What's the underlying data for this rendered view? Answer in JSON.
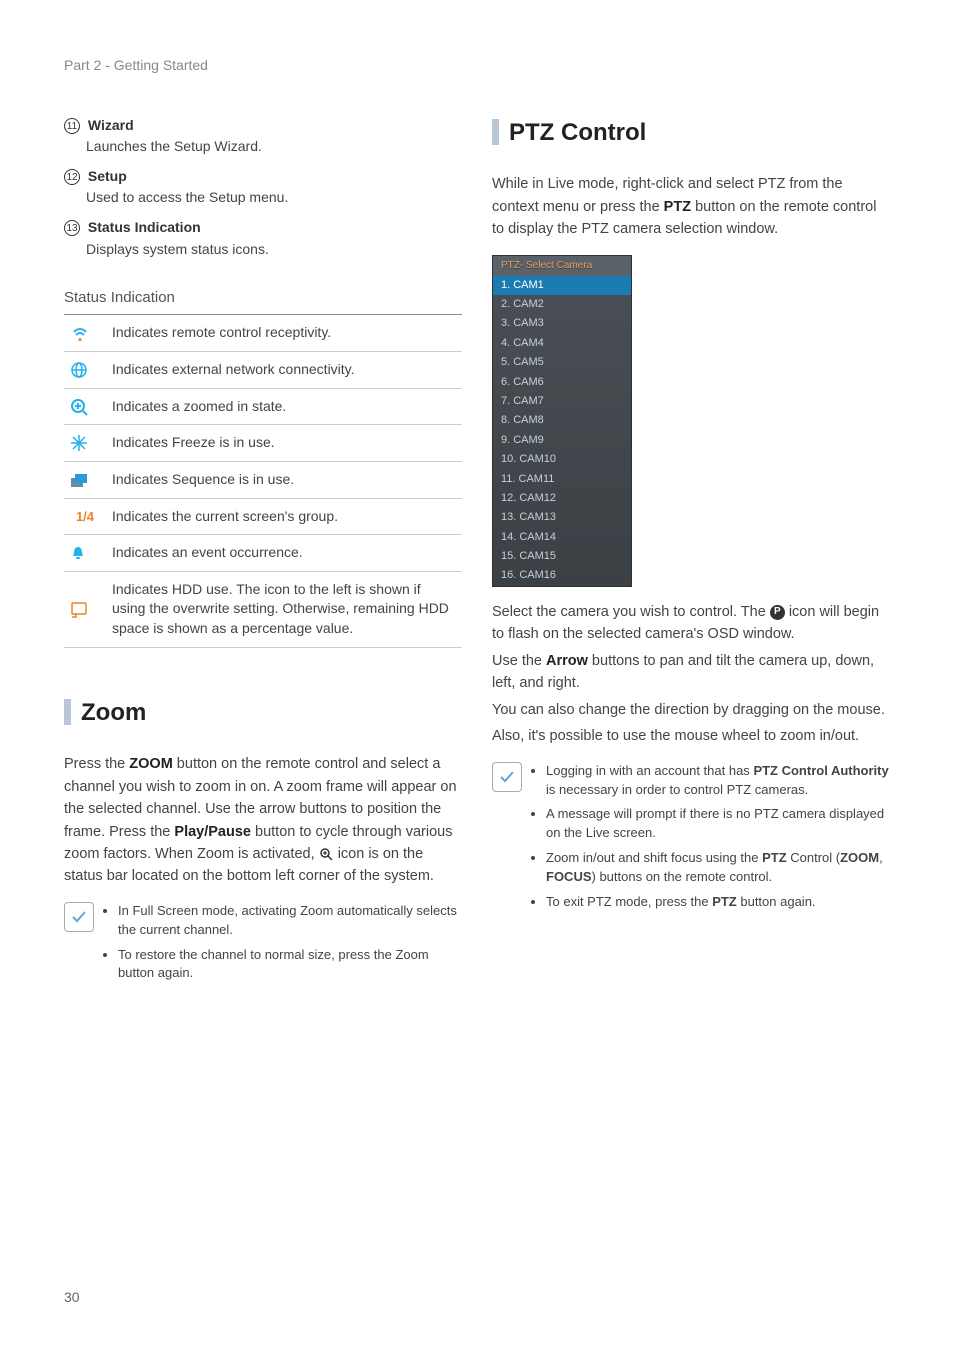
{
  "header": {
    "breadcrumb": "Part 2 - Getting Started"
  },
  "left": {
    "items": [
      {
        "num": "⑪",
        "title": "Wizard",
        "desc": "Launches the Setup Wizard."
      },
      {
        "num": "⑫",
        "title": "Setup",
        "desc": "Used to access the Setup menu."
      },
      {
        "num": "⑬",
        "title": " Status Indication",
        "desc": "Displays system status icons."
      }
    ],
    "status_heading": "Status Indication",
    "status_rows": [
      {
        "icon": "remote",
        "desc": "Indicates remote control receptivity."
      },
      {
        "icon": "globe",
        "desc": "Indicates external network connectivity."
      },
      {
        "icon": "zoomin",
        "desc": "Indicates a zoomed in state."
      },
      {
        "icon": "freeze",
        "desc": "Indicates Freeze is in use."
      },
      {
        "icon": "seq",
        "desc": "Indicates Sequence is in use."
      },
      {
        "icon": "group",
        "label": "1/4",
        "desc": "Indicates the current screen's group."
      },
      {
        "icon": "event",
        "desc": "Indicates an event occurrence."
      },
      {
        "icon": "hdd",
        "desc": "Indicates HDD use. The icon to the left is shown if using the overwrite setting. Otherwise, remaining HDD space is shown as a percentage value."
      }
    ],
    "zoom_title": "Zoom",
    "zoom_body_parts": [
      "Press the ",
      "ZOOM",
      " button on the remote control and select a channel you wish to zoom in on. A zoom frame will appear on the selected channel. Use the arrow buttons to position the frame. Press the ",
      "Play/Pause",
      " button to cycle through various zoom factors. When Zoom is activated, ",
      " icon is on the status bar located on the bottom left corner of the system."
    ],
    "zoom_notes": [
      "In Full Screen mode, activating Zoom automatically selects the current channel.",
      "To restore the channel to normal size, press the Zoom button again."
    ]
  },
  "right": {
    "ptz_title": "PTZ Control",
    "ptz_intro_parts": [
      "While in Live mode, right-click and select PTZ from the context menu or press the ",
      "PTZ",
      " button on the remote control to display the PTZ camera selection window."
    ],
    "ptz_window_title": "PTZ- Select Camera",
    "ptz_cameras": [
      "1. CAM1",
      "2. CAM2",
      "3. CAM3",
      "4. CAM4",
      "5. CAM5",
      "6. CAM6",
      "7. CAM7",
      "8. CAM8",
      "9. CAM9",
      "10. CAM10",
      "11. CAM11",
      "12. CAM12",
      "13. CAM13",
      "14. CAM14",
      "15. CAM15",
      "16. CAM16"
    ],
    "ptz_p1_a": "Select the camera you wish to control. The ",
    "ptz_p1_b": " icon will begin to flash on the selected camera's OSD window.",
    "ptz_p2_a": "Use the ",
    "ptz_p2_bold": "Arrow",
    "ptz_p2_b": " buttons to pan and tilt the camera up, down, left, and right.",
    "ptz_p3": "You can also change the direction by dragging on the mouse.",
    "ptz_p4": "Also, it's possible to use the mouse wheel to zoom in/out.",
    "ptz_notes": [
      {
        "pre": "Logging in with an account that has ",
        "bold": "PTZ Control Authority",
        "post": " is necessary in order to control PTZ cameras."
      },
      {
        "text": "A message will prompt if there is no PTZ camera displayed on the Live screen."
      },
      {
        "pre": "Zoom in/out and shift focus using the ",
        "bold": "PTZ",
        "post_a": " Control (",
        "bold2": "ZOOM",
        "mid": ", ",
        "bold3": "FOCUS",
        "post_b": ") buttons on the remote control."
      },
      {
        "pre": "To exit PTZ mode, press the ",
        "bold": "PTZ",
        "post": " button again."
      }
    ]
  },
  "page_number": "30"
}
